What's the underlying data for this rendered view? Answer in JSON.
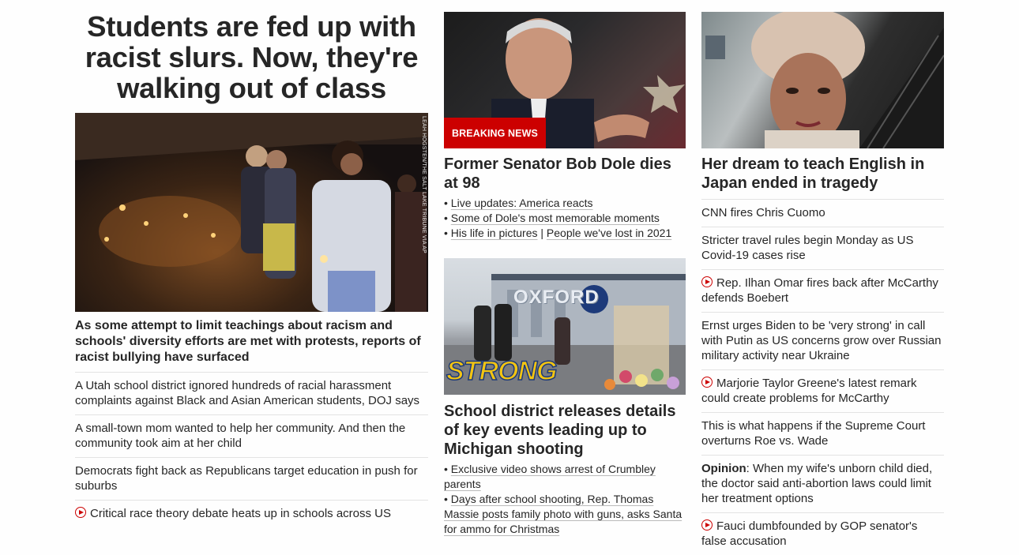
{
  "left": {
    "headline": "Students are fed up with racist slurs. Now, they're walking out of class",
    "photo_credit": "LEAH HOGSTEN/THE SALT LAKE TRIBUNE VIA AP",
    "lead": "As some attempt to limit teachings about racism and schools' diversity efforts are met with protests, reports of racist bullying have surfaced",
    "links": [
      "A Utah school district ignored hundreds of racial harassment complaints against Black and Asian American students, DOJ says",
      "A small-town mom wanted to help her community. And then the community took aim at her child",
      "Democrats fight back as Republicans target education in push for suburbs",
      "Critical race theory debate heats up in schools across US"
    ]
  },
  "middle": {
    "badge": "BREAKING NEWS",
    "headline1": "Former Senator Bob Dole dies at 98",
    "bullets1": {
      "b1": "Live updates: America reacts",
      "b2": "Some of Dole's most memorable moments",
      "b3a": "His life in pictures",
      "sep": " | ",
      "b3b": "People we've lost in 2021"
    },
    "image2_text1": "OXFORD",
    "image2_text2": "STRONG",
    "headline2": "School district releases details of key events leading up to Michigan shooting",
    "bullets2": [
      "Exclusive video shows arrest of Crumbley parents",
      "Days after school shooting, Rep. Thomas Massie posts family photo with guns, asks Santa for ammo for Christmas"
    ]
  },
  "right": {
    "headline": "Her dream to teach English in Japan ended in tragedy",
    "links": [
      "CNN fires Chris Cuomo",
      "Stricter travel rules begin Monday as US Covid-19 cases rise",
      "Rep. Ilhan Omar fires back after McCarthy defends Boebert",
      "Ernst urges Biden to be 'very strong' in call with Putin as US concerns grow over Russian military activity near Ukraine",
      "Marjorie Taylor Greene's latest remark could create problems for McCarthy",
      "This is what happens if the Supreme Court overturns Roe vs. Wade"
    ],
    "opinion_label": "Opinion",
    "opinion_text": ": When my wife's unborn child died, the doctor said anti-abortion laws could limit her treatment options",
    "last_link": "Fauci dumbfounded by GOP senator's false accusation"
  },
  "colors": {
    "accent": "#cc0000",
    "text": "#262626",
    "divider": "#e3e3e3"
  }
}
